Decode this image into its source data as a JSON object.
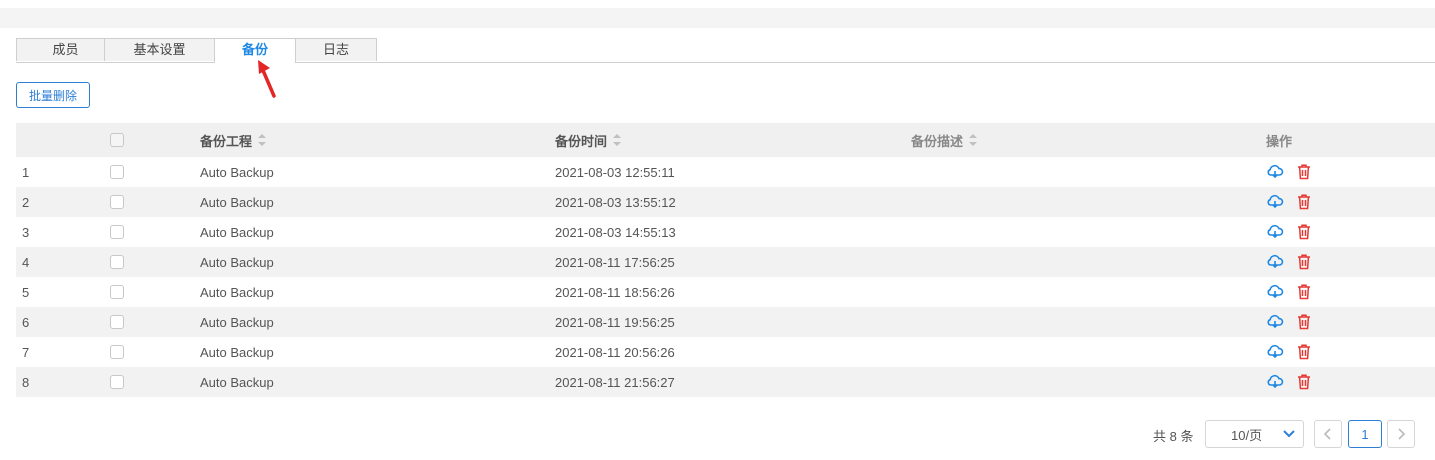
{
  "tabs": [
    "成员",
    "基本设置",
    "备份",
    "日志"
  ],
  "active_tab": 2,
  "batch_delete_label": "批量删除",
  "columns": {
    "project": "备份工程",
    "time": "备份时间",
    "description": "备份描述",
    "actions": "操作"
  },
  "rows": [
    {
      "idx": "1",
      "project": "Auto Backup",
      "time": "2021-08-03 12:55:11",
      "desc": ""
    },
    {
      "idx": "2",
      "project": "Auto Backup",
      "time": "2021-08-03 13:55:12",
      "desc": ""
    },
    {
      "idx": "3",
      "project": "Auto Backup",
      "time": "2021-08-03 14:55:13",
      "desc": ""
    },
    {
      "idx": "4",
      "project": "Auto Backup",
      "time": "2021-08-11 17:56:25",
      "desc": ""
    },
    {
      "idx": "5",
      "project": "Auto Backup",
      "time": "2021-08-11 18:56:26",
      "desc": ""
    },
    {
      "idx": "6",
      "project": "Auto Backup",
      "time": "2021-08-11 19:56:25",
      "desc": ""
    },
    {
      "idx": "7",
      "project": "Auto Backup",
      "time": "2021-08-11 20:56:26",
      "desc": ""
    },
    {
      "idx": "8",
      "project": "Auto Backup",
      "time": "2021-08-11 21:56:27",
      "desc": ""
    }
  ],
  "row_icons": [
    "cloud-restore-icon",
    "trash-icon"
  ],
  "pagination": {
    "total_text": "共 8 条",
    "page_size": "10/页",
    "current_page": "1"
  },
  "colors": {
    "accent": "#1e88e5",
    "delete": "#e53935",
    "header_bg": "#f0f0f0"
  }
}
